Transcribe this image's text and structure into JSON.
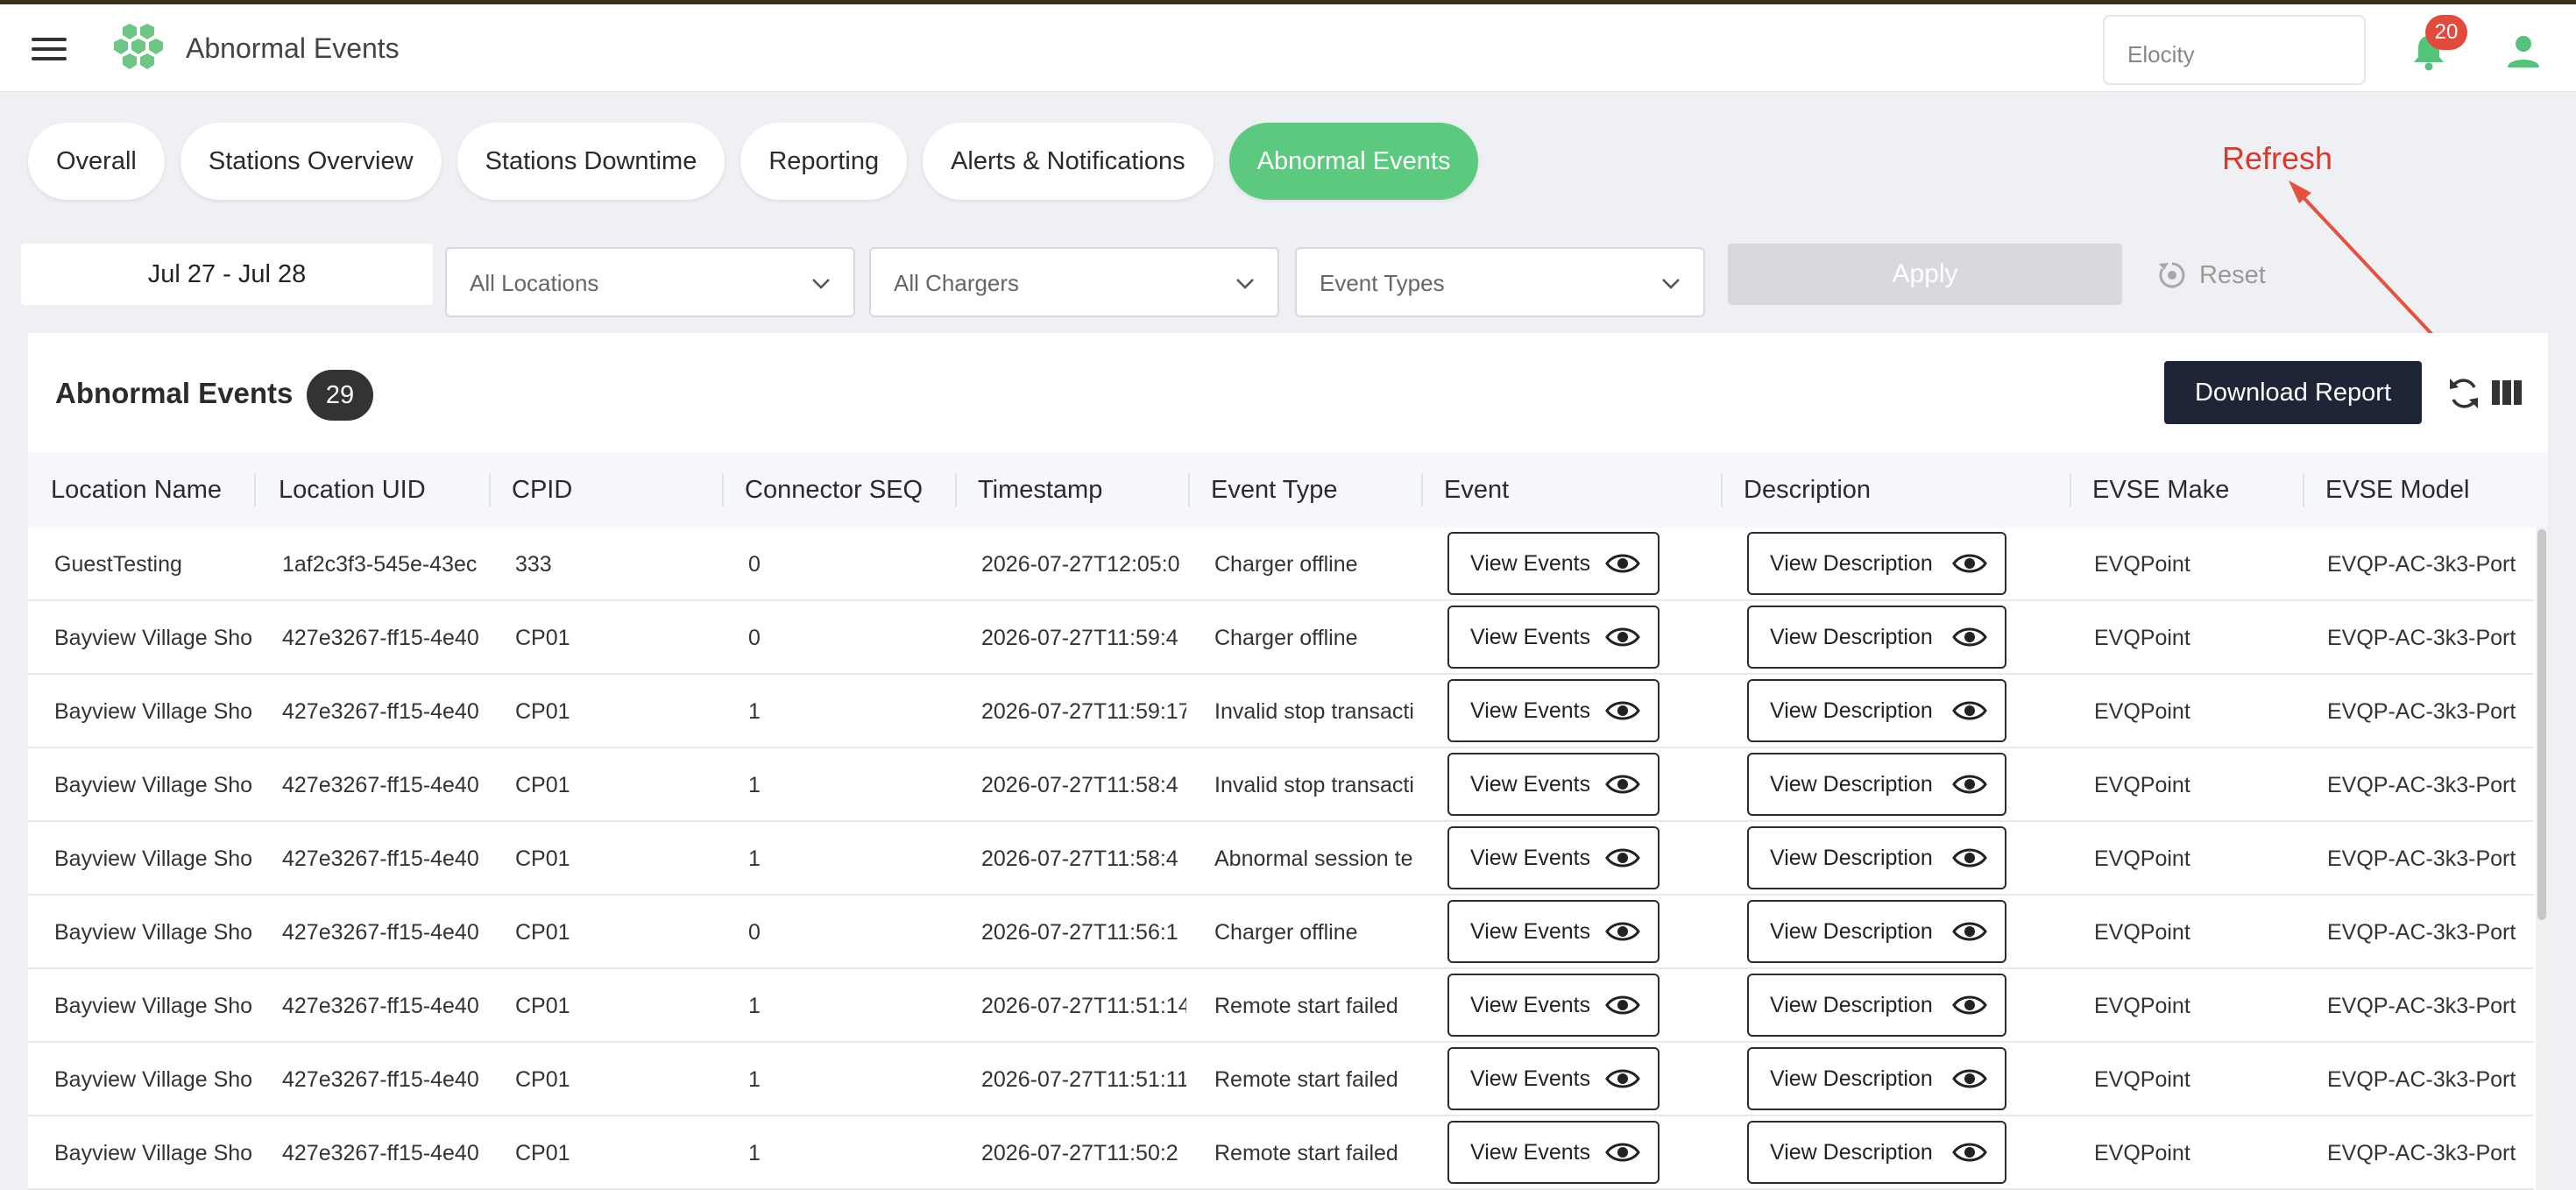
{
  "header": {
    "title": "Abnormal Events",
    "org_select_value": "Elocity",
    "notification_count": "20"
  },
  "tabs": [
    {
      "label": "Overall",
      "active": false
    },
    {
      "label": "Stations Overview",
      "active": false
    },
    {
      "label": "Stations Downtime",
      "active": false
    },
    {
      "label": "Reporting",
      "active": false
    },
    {
      "label": "Alerts & Notifications",
      "active": false
    },
    {
      "label": "Abnormal Events",
      "active": true
    }
  ],
  "filters": {
    "date_range": "Jul 27 - Jul 28",
    "locations": "All Locations",
    "chargers": "All Chargers",
    "event_types": "Event Types",
    "apply_label": "Apply",
    "reset_label": "Reset"
  },
  "annotation": {
    "label": "Refresh"
  },
  "table": {
    "title": "Abnormal Events",
    "count": "29",
    "download_label": "Download Report",
    "columns": [
      "Location Name",
      "Location UID",
      "CPID",
      "Connector SEQ",
      "Timestamp",
      "Event Type",
      "Event",
      "Description",
      "EVSE Make",
      "EVSE Model"
    ],
    "view_events_label": "View Events",
    "view_description_label": "View Description",
    "rows": [
      {
        "location": "GuestTesting",
        "uid": "1af2c3f3-545e-43ec",
        "cpid": "333",
        "connector": "0",
        "timestamp": "2026-07-27T12:05:0",
        "event_type": "Charger offline",
        "make": "EVQPoint",
        "model": "EVQP-AC-3k3-Port"
      },
      {
        "location": "Bayview Village Sho",
        "uid": "427e3267-ff15-4e40",
        "cpid": "CP01",
        "connector": "0",
        "timestamp": "2026-07-27T11:59:4",
        "event_type": "Charger offline",
        "make": "EVQPoint",
        "model": "EVQP-AC-3k3-Port"
      },
      {
        "location": "Bayview Village Sho",
        "uid": "427e3267-ff15-4e40",
        "cpid": "CP01",
        "connector": "1",
        "timestamp": "2026-07-27T11:59:17",
        "event_type": "Invalid stop transacti",
        "make": "EVQPoint",
        "model": "EVQP-AC-3k3-Port"
      },
      {
        "location": "Bayview Village Sho",
        "uid": "427e3267-ff15-4e40",
        "cpid": "CP01",
        "connector": "1",
        "timestamp": "2026-07-27T11:58:4",
        "event_type": "Invalid stop transacti",
        "make": "EVQPoint",
        "model": "EVQP-AC-3k3-Port"
      },
      {
        "location": "Bayview Village Sho",
        "uid": "427e3267-ff15-4e40",
        "cpid": "CP01",
        "connector": "1",
        "timestamp": "2026-07-27T11:58:4",
        "event_type": "Abnormal session te",
        "make": "EVQPoint",
        "model": "EVQP-AC-3k3-Port"
      },
      {
        "location": "Bayview Village Sho",
        "uid": "427e3267-ff15-4e40",
        "cpid": "CP01",
        "connector": "0",
        "timestamp": "2026-07-27T11:56:1",
        "event_type": "Charger offline",
        "make": "EVQPoint",
        "model": "EVQP-AC-3k3-Port"
      },
      {
        "location": "Bayview Village Sho",
        "uid": "427e3267-ff15-4e40",
        "cpid": "CP01",
        "connector": "1",
        "timestamp": "2026-07-27T11:51:14",
        "event_type": "Remote start failed",
        "make": "EVQPoint",
        "model": "EVQP-AC-3k3-Port"
      },
      {
        "location": "Bayview Village Sho",
        "uid": "427e3267-ff15-4e40",
        "cpid": "CP01",
        "connector": "1",
        "timestamp": "2026-07-27T11:51:11.",
        "event_type": "Remote start failed",
        "make": "EVQPoint",
        "model": "EVQP-AC-3k3-Port"
      },
      {
        "location": "Bayview Village Sho",
        "uid": "427e3267-ff15-4e40",
        "cpid": "CP01",
        "connector": "1",
        "timestamp": "2026-07-27T11:50:2",
        "event_type": "Remote start failed",
        "make": "EVQPoint",
        "model": "EVQP-AC-3k3-Port"
      }
    ]
  },
  "colors": {
    "accent": "#5bca7f",
    "primary_button": "#1d2536",
    "badge": "#e24a3b",
    "annotation": "#d9392a"
  },
  "icons": [
    "hamburger-icon",
    "hexagon-logo-icon",
    "bell-icon",
    "user-icon",
    "chevron-down-icon",
    "reset-icon",
    "refresh-icon",
    "columns-icon",
    "eye-icon"
  ]
}
